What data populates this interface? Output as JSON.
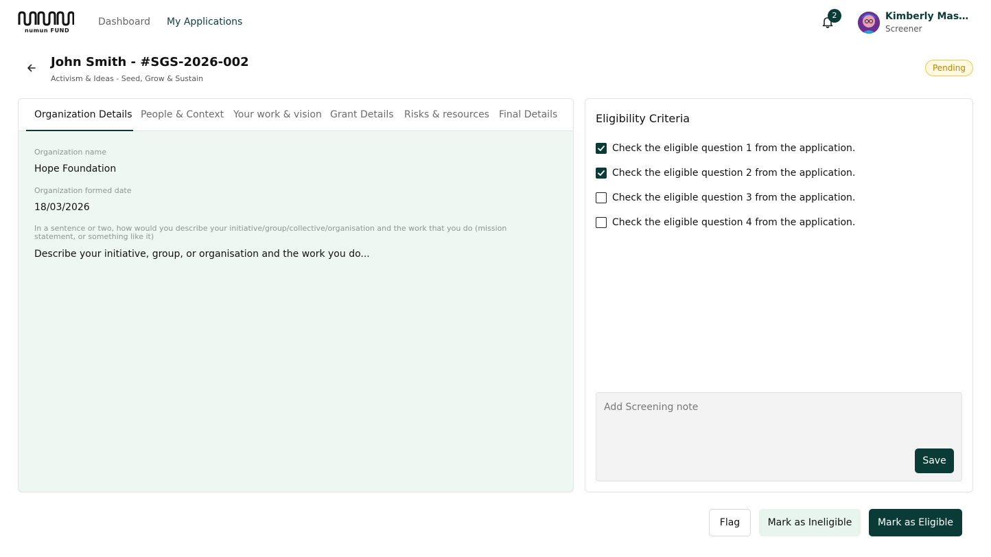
{
  "brand": {
    "logo_text": "numun FUND"
  },
  "nav": {
    "items": [
      {
        "label": "Dashboard",
        "active": false
      },
      {
        "label": "My Applications",
        "active": true
      }
    ]
  },
  "notifications": {
    "count": "2",
    "icon": "bell-icon"
  },
  "user": {
    "name": "Kimberly Mastra...",
    "role": "Screener"
  },
  "application": {
    "title": "John Smith - #SGS-2026-002",
    "subtitle": "Activism & Ideas - Seed, Grow & Sustain",
    "status": "Pending",
    "status_color": "#f0c94a"
  },
  "tabs": [
    {
      "label": "Organization Details",
      "active": true
    },
    {
      "label": "People & Context",
      "active": false
    },
    {
      "label": "Your work & vision",
      "active": false
    },
    {
      "label": "Grant Details",
      "active": false
    },
    {
      "label": "Risks & resources",
      "active": false
    },
    {
      "label": "Final Details",
      "active": false
    }
  ],
  "fields": [
    {
      "label": "Organization name",
      "value": "Hope Foundation"
    },
    {
      "label": "Organization formed date",
      "value": "18/03/2026"
    },
    {
      "label": "In a sentence or two, how would you describe your initiative/group/collective/organisation and the work that you do (mission statement, or something like it)",
      "value": "Describe your initiative, group, or organisation and the work you do..."
    }
  ],
  "eligibility": {
    "title": "Eligibility Criteria",
    "criteria": [
      {
        "label": "Check the eligible question 1 from the application.",
        "checked": true
      },
      {
        "label": "Check the eligible question 2 from the application.",
        "checked": true
      },
      {
        "label": "Check the eligible question 3 from the application.",
        "checked": false
      },
      {
        "label": "Check the eligible question 4 from the application.",
        "checked": false
      }
    ],
    "note_placeholder": "Add Screening note",
    "save_label": "Save"
  },
  "actions": {
    "flag_label": "Flag",
    "ineligible_label": "Mark as Ineligible",
    "eligible_label": "Mark as Eligible"
  },
  "colors": {
    "accent": "#0b3b36",
    "panel_tint": "#eef7f1"
  }
}
